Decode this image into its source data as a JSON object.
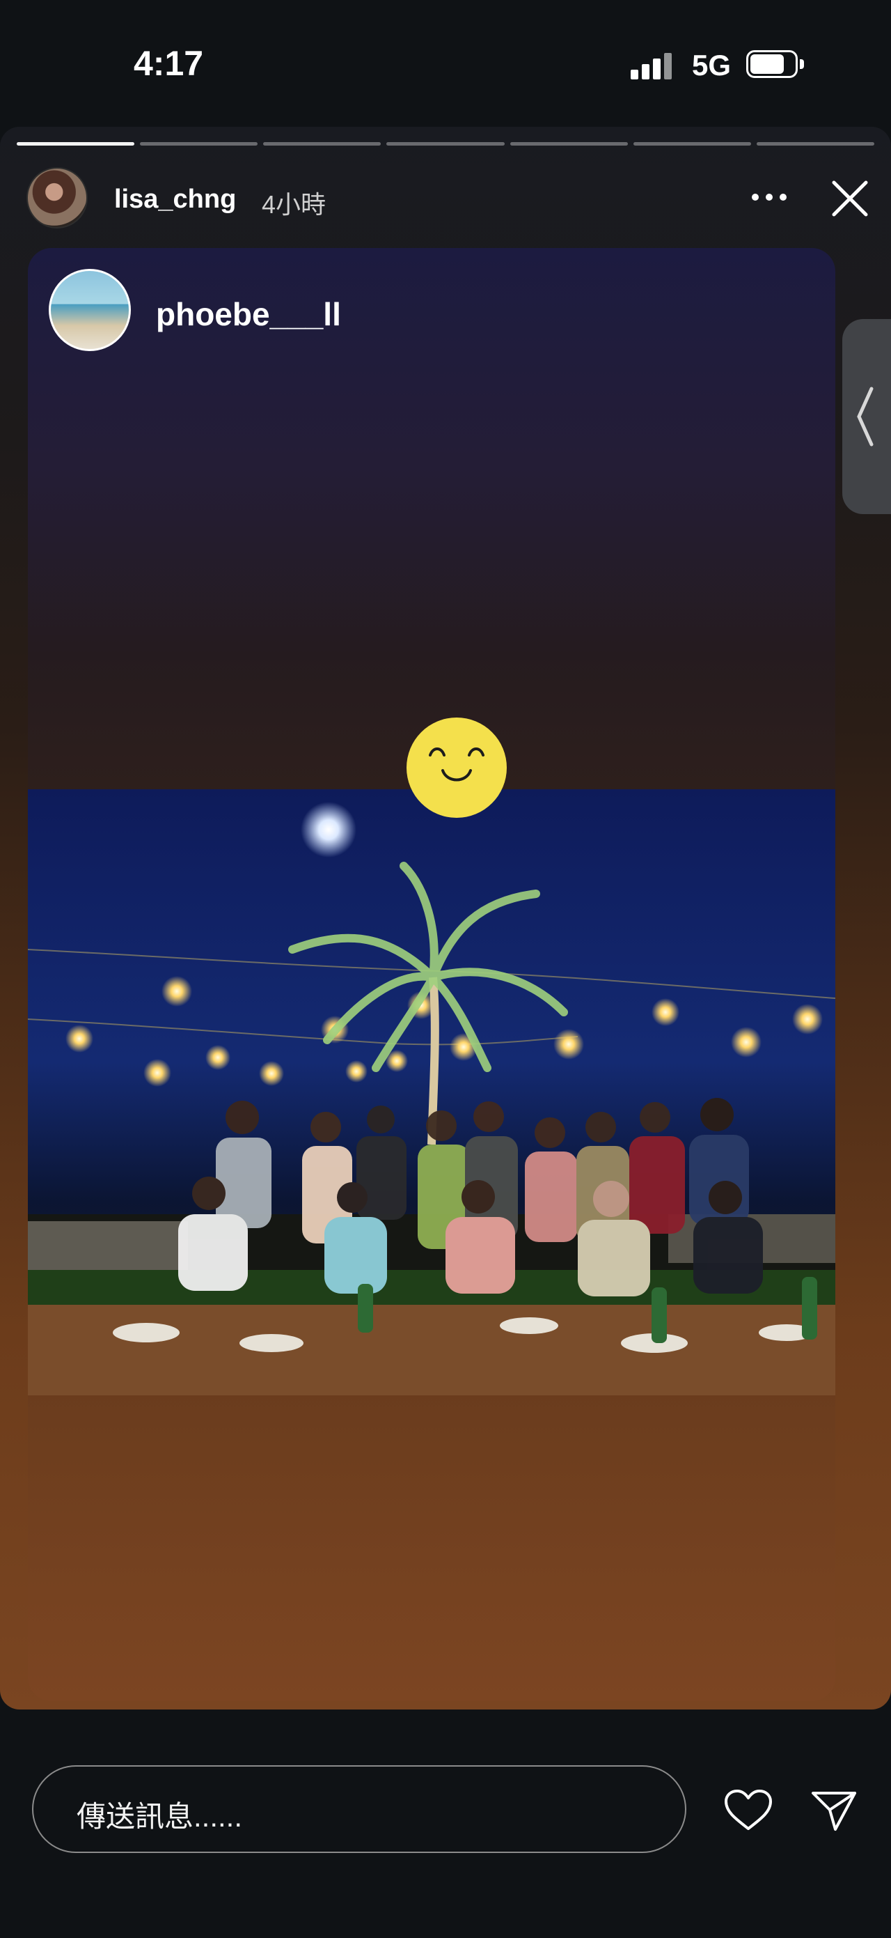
{
  "status_bar": {
    "time": "4:17",
    "network": "5G"
  },
  "story": {
    "owner": "lisa_chng",
    "time_ago": "4小時",
    "progress": {
      "segments": 7,
      "completed": 1
    }
  },
  "shared_post": {
    "author": "phoebe___ll"
  },
  "reply": {
    "placeholder": "傳送訊息......"
  }
}
